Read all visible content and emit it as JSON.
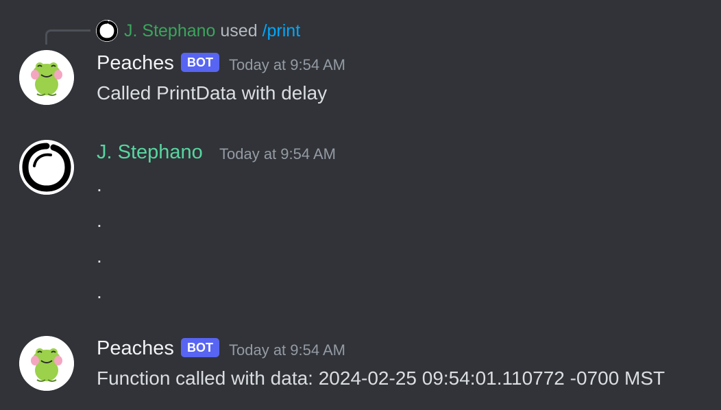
{
  "interaction": {
    "user": "J. Stephano",
    "verb": "used",
    "command": "/print"
  },
  "messages": [
    {
      "author": "Peaches",
      "tag": "BOT",
      "timestamp": "Today at 9:54 AM",
      "lines": [
        "Called PrintData with delay"
      ]
    },
    {
      "author": "J. Stephano",
      "timestamp": "Today at 9:54 AM",
      "lines": [
        ".",
        ".",
        ".",
        "."
      ]
    },
    {
      "author": "Peaches",
      "tag": "BOT",
      "timestamp": "Today at 9:54 AM",
      "lines": [
        "Function called with data: 2024-02-25 09:54:01.110772 -0700 MST"
      ]
    }
  ],
  "colors": {
    "background": "#313338",
    "bot_tag": "#5865f2",
    "human_name": "#57d6a0",
    "command_link": "#00a8fc"
  },
  "icons": {
    "bot_avatar": "frog-avatar-icon",
    "user_avatar": "enso-circle-avatar-icon"
  }
}
